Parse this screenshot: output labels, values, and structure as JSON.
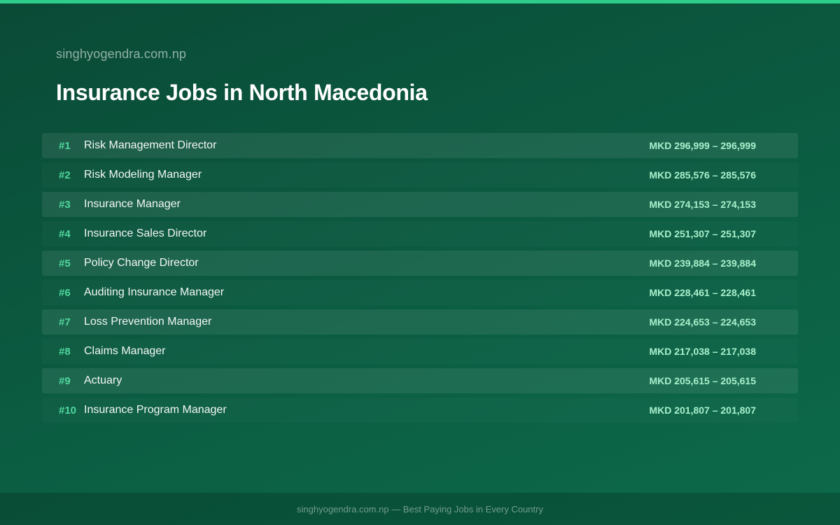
{
  "header": {
    "site_name": "singhyogendra.com.np",
    "title": "Insurance Jobs in North Macedonia"
  },
  "jobs": [
    {
      "rank": "#1",
      "title": "Risk Management Director",
      "salary": "MKD 296,999 – 296,999"
    },
    {
      "rank": "#2",
      "title": "Risk Modeling Manager",
      "salary": "MKD 285,576 – 285,576"
    },
    {
      "rank": "#3",
      "title": "Insurance Manager",
      "salary": "MKD 274,153 – 274,153"
    },
    {
      "rank": "#4",
      "title": "Insurance Sales Director",
      "salary": "MKD 251,307 – 251,307"
    },
    {
      "rank": "#5",
      "title": "Policy Change Director",
      "salary": "MKD 239,884 – 239,884"
    },
    {
      "rank": "#6",
      "title": "Auditing Insurance Manager",
      "salary": "MKD 228,461 – 228,461"
    },
    {
      "rank": "#7",
      "title": "Loss Prevention Manager",
      "salary": "MKD 224,653 – 224,653"
    },
    {
      "rank": "#8",
      "title": "Claims Manager",
      "salary": "MKD 217,038 – 217,038"
    },
    {
      "rank": "#9",
      "title": "Actuary",
      "salary": "MKD 205,615 – 205,615"
    },
    {
      "rank": "#10",
      "title": "Insurance Program Manager",
      "salary": "MKD 201,807 – 201,807"
    }
  ],
  "footer": {
    "text": "singhyogendra.com.np — Best Paying Jobs in Every Country"
  },
  "colors": {
    "accent": "#2ecc8a",
    "rank": "#4fd69c",
    "salary": "#a8f0cc",
    "background": "#0b5a40"
  }
}
